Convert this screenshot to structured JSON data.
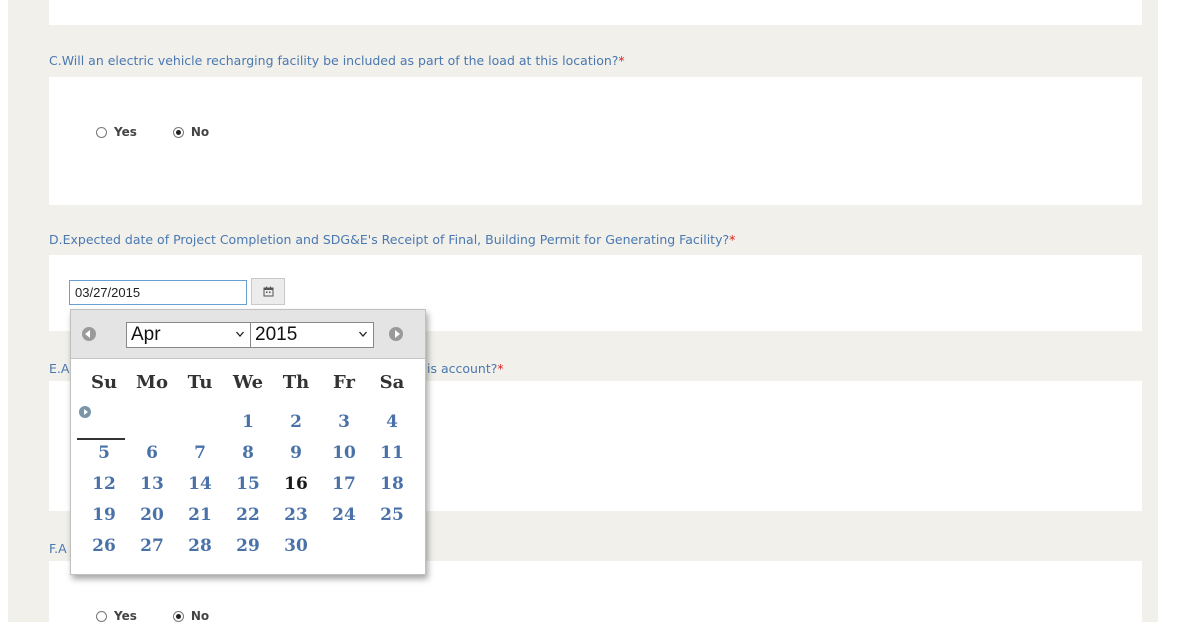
{
  "questions": {
    "c": {
      "text": "C.Will an electric vehicle recharging facility be included as part of the load at this location?",
      "required_mark": "*",
      "options": {
        "yes": "Yes",
        "no": "No"
      },
      "selected": "No"
    },
    "d": {
      "text": "D.Expected date of Project Completion and SDG&E's Receipt of Final, Building Permit for Generating Facility?",
      "required_mark": "*",
      "date_value": "03/27/2015"
    },
    "e": {
      "text_start": "E.A",
      "text_end": "is account?",
      "required_mark": "*"
    },
    "f": {
      "text_start": "F.A",
      "options": {
        "yes": "Yes",
        "no": "No"
      },
      "selected": "No"
    }
  },
  "datepicker": {
    "month": "Apr",
    "year": "2015",
    "weekdays": [
      "Su",
      "Mo",
      "Tu",
      "We",
      "Th",
      "Fr",
      "Sa"
    ],
    "weeks": [
      [
        "",
        "",
        "",
        "1",
        "2",
        "3",
        "4"
      ],
      [
        "5",
        "6",
        "7",
        "8",
        "9",
        "10",
        "11"
      ],
      [
        "12",
        "13",
        "14",
        "15",
        "16",
        "17",
        "18"
      ],
      [
        "19",
        "20",
        "21",
        "22",
        "23",
        "24",
        "25"
      ],
      [
        "26",
        "27",
        "28",
        "29",
        "30",
        "",
        ""
      ]
    ],
    "highlighted_day": "16"
  },
  "icons": {
    "calendar_button": "calendar-icon",
    "prev": "prev-month-icon",
    "next": "next-month-icon",
    "week_select": "week-select-icon"
  },
  "colors": {
    "question_text": "#4a78b0",
    "required": "#e02020",
    "day_link": "#4a72a8",
    "panel_background": "#f1f0eb"
  }
}
